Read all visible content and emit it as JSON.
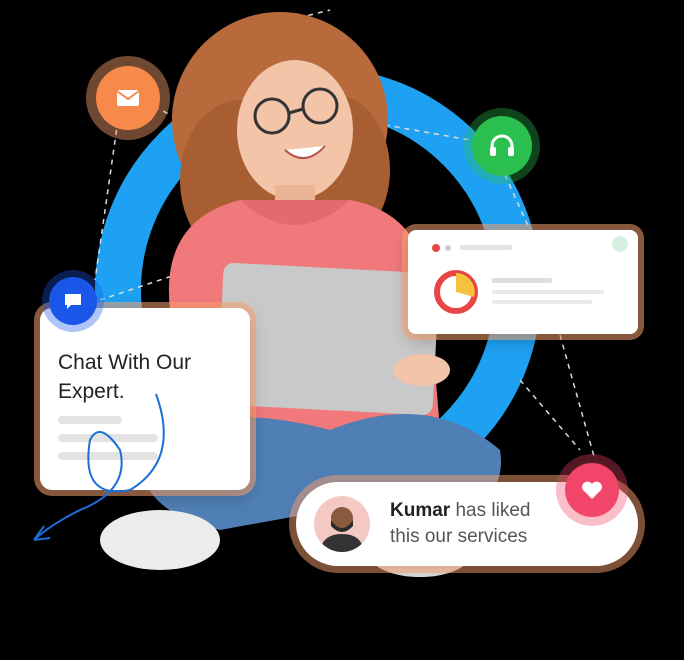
{
  "chat_card": {
    "title_line1": "Chat With Our",
    "title_line2": "Expert."
  },
  "notification": {
    "name": "Kumar",
    "line1_rest": " has liked",
    "line2": "this our services"
  },
  "icons": {
    "mail": "mail-icon",
    "headset": "headset-icon",
    "chat": "chat-bubble-icon",
    "heart": "heart-icon",
    "donut": "donut-chart-icon"
  },
  "colors": {
    "ring_blue": "#1ea1f2",
    "bubble_orange": "#f7894a",
    "bubble_green": "#2bbf4f",
    "bubble_blue": "#1a56e8",
    "bubble_pink": "#f2456a",
    "card_glow": "#f7a06e",
    "donut_red": "#e84545",
    "donut_yellow": "#f6c23e"
  }
}
